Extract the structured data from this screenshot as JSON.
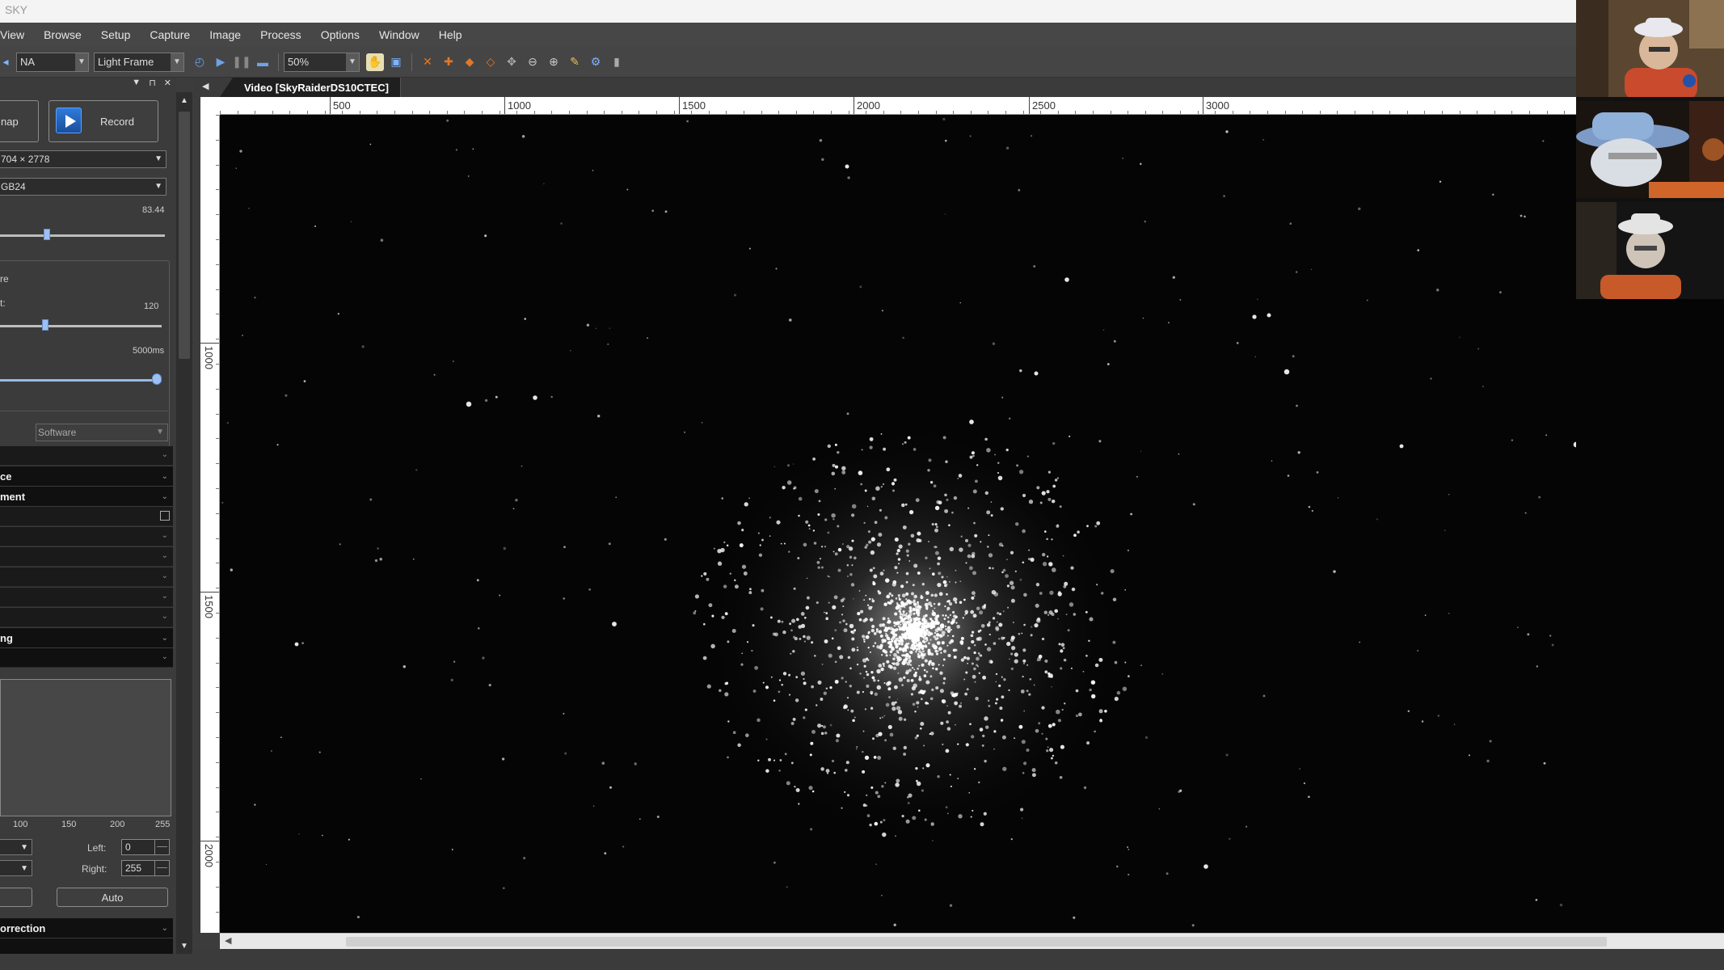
{
  "window": {
    "title": "SKY"
  },
  "menu": [
    "View",
    "Browse",
    "Setup",
    "Capture",
    "Image",
    "Process",
    "Options",
    "Window",
    "Help"
  ],
  "toolbar": {
    "camera_select": "NA",
    "frame_type": "Light Frame",
    "zoom": "50%"
  },
  "left_panel": {
    "snap_label": "nap",
    "record_label": "Record",
    "resolution": "704 × 2778",
    "format": "GB24",
    "gain_value": "83.44",
    "group_label": "re",
    "offset_label": "t:",
    "offset_value": "120",
    "exposure_value": "5000ms",
    "trigger_select": "Software",
    "sections": {
      "s1": "ce",
      "s2": "ment",
      "s3": "ng",
      "s4": "orrection"
    },
    "histogram_ticks": [
      "100",
      "150",
      "200",
      "255"
    ],
    "left_label": "Left:",
    "left_value": "0",
    "right_label": "Right:",
    "right_value": "255",
    "auto_label": "Auto"
  },
  "document": {
    "tab_title": "Video [SkyRaiderDS10CTEC]"
  },
  "ruler": {
    "h_labels": [
      "500",
      "1000",
      "1500",
      "2000",
      "2500",
      "3000"
    ],
    "v_labels": [
      "1000",
      "1500",
      "2000"
    ]
  },
  "image": {
    "subject": "globular star cluster",
    "background": "#050505",
    "star_color": "#ffffff"
  },
  "colors": {
    "menu_bg": "#474747",
    "panel_bg": "#3b3b3b",
    "accent": "#2f7bd9"
  }
}
